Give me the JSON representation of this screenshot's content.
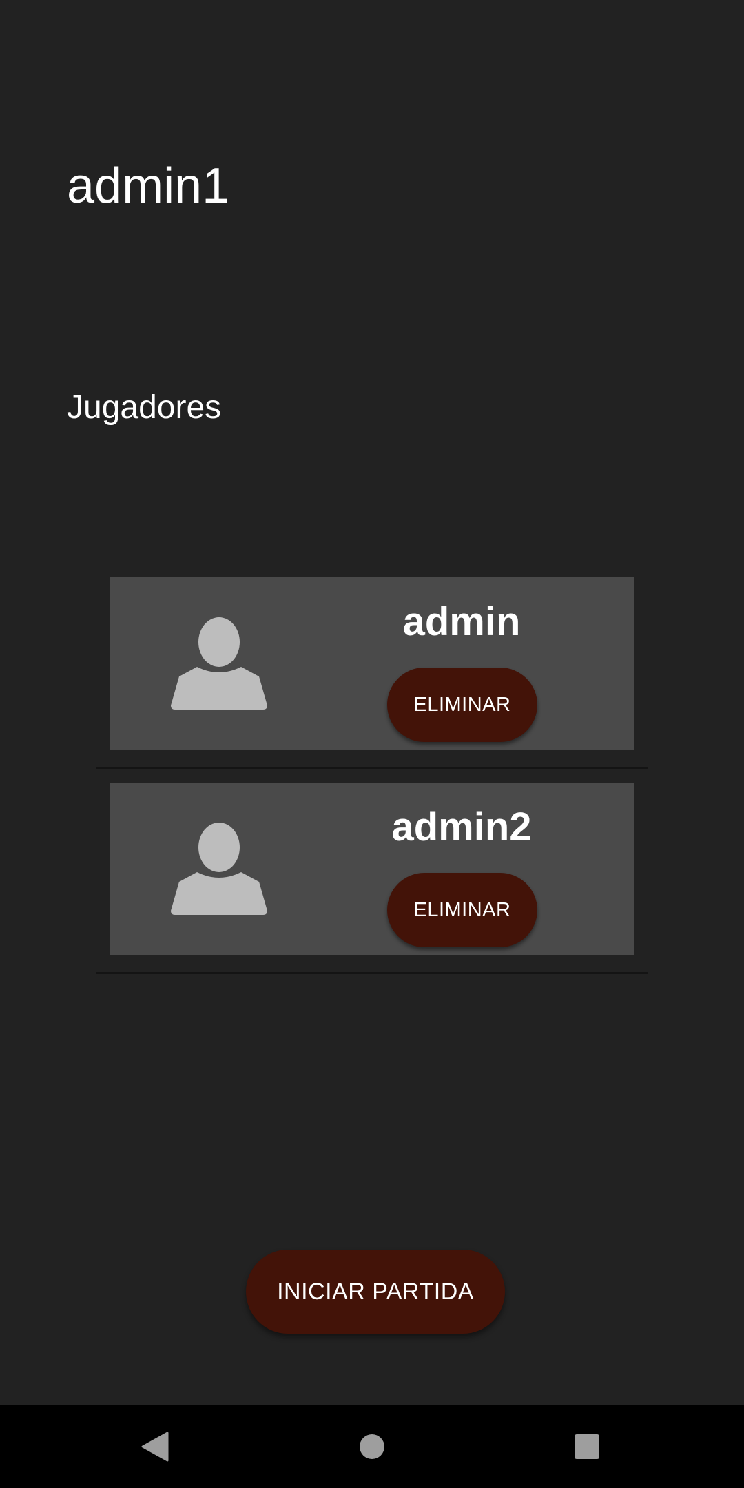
{
  "header": {
    "title": "admin1"
  },
  "section": {
    "label": "Jugadores"
  },
  "players": [
    {
      "name": "admin",
      "remove_label": "ELIMINAR",
      "avatar_icon": "person-icon"
    },
    {
      "name": "admin2",
      "remove_label": "ELIMINAR",
      "avatar_icon": "person-icon"
    }
  ],
  "actions": {
    "start_label": "INICIAR PARTIDA"
  },
  "navigation": {
    "back_icon": "back-triangle-icon",
    "home_icon": "home-circle-icon",
    "recents_icon": "recents-square-icon"
  },
  "colors": {
    "background": "#222222",
    "card": "#4a4a4a",
    "button": "#431308",
    "avatar": "#bdbdbd",
    "nav_icon": "#9e9e9e"
  }
}
